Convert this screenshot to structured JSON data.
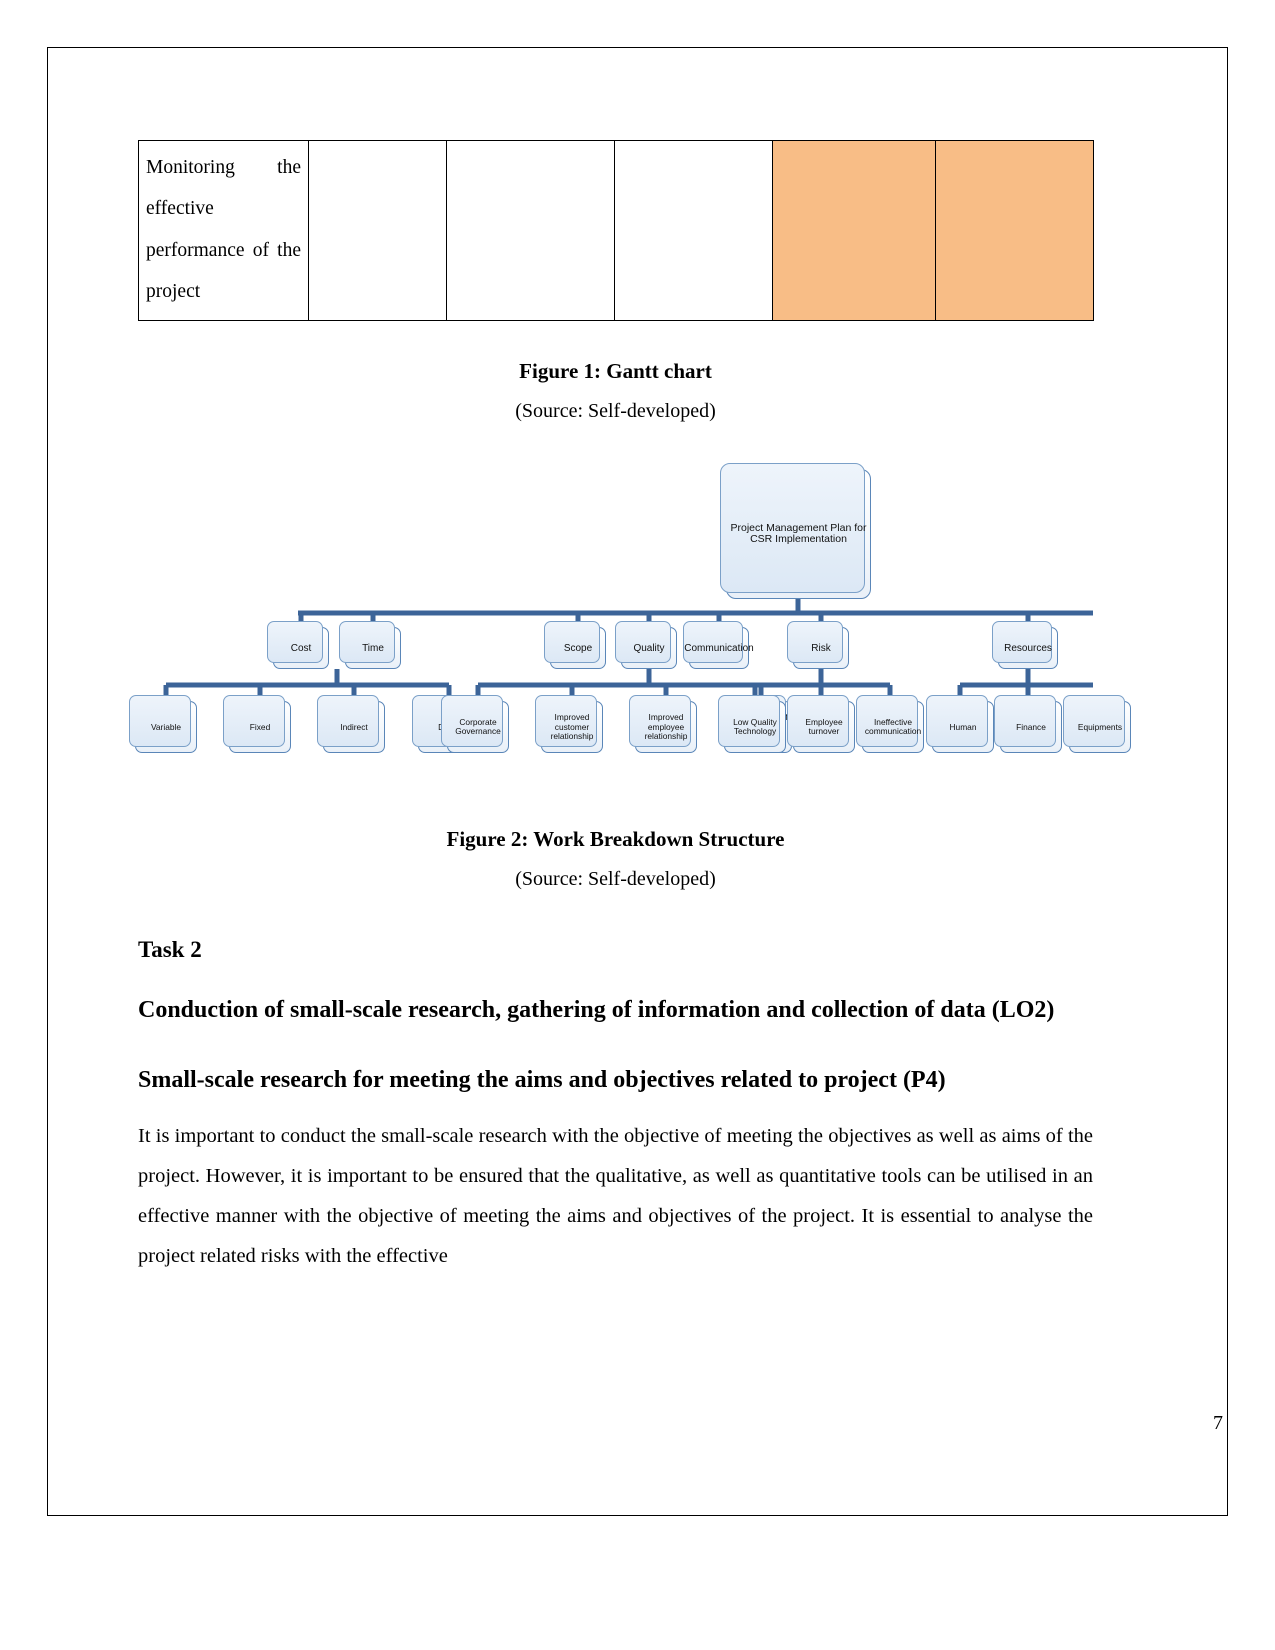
{
  "page": {
    "number": "7"
  },
  "gantt_table": {
    "row_label": "Monitoring the effective performance of the project",
    "cells": [
      {
        "filled": false
      },
      {
        "filled": false
      },
      {
        "filled": false
      },
      {
        "filled": true
      },
      {
        "filled": true
      }
    ],
    "fill_color": "#f8bd86"
  },
  "figures": [
    {
      "caption": "Figure 1: Gantt chart",
      "source": "(Source: Self-developed)"
    },
    {
      "caption": "Figure 2: Work Breakdown Structure",
      "source": "(Source: Self-developed)"
    }
  ],
  "wbs": {
    "root": "Project Management Plan for CSR Implementation",
    "level2": [
      {
        "label": "Cost"
      },
      {
        "label": "Time"
      },
      {
        "label": "Scope"
      },
      {
        "label": "Quality"
      },
      {
        "label": "Communication"
      },
      {
        "label": "Risk"
      },
      {
        "label": "Resources"
      }
    ],
    "level3": [
      {
        "label": "Variable"
      },
      {
        "label": "Fixed"
      },
      {
        "label": "Indirect"
      },
      {
        "label": "Direct"
      },
      {
        "label": "Corporate Governance"
      },
      {
        "label": "Improved customer relationship"
      },
      {
        "label": "Improved employee relationship"
      },
      {
        "label": "Deliverance of business outcome"
      },
      {
        "label": "Low Quality Technology"
      },
      {
        "label": "Employee turnover"
      },
      {
        "label": "Ineffective communication"
      },
      {
        "label": "Human"
      },
      {
        "label": "Finance"
      },
      {
        "label": "Equipments"
      }
    ],
    "line_color": "#3c6498"
  },
  "headings": {
    "task": "Task 2",
    "lo2": "Conduction of small-scale research, gathering of information and collection of data (LO2)",
    "p4": "Small-scale research for meeting the aims and objectives related to project (P4)"
  },
  "paragraph": "It is important to conduct the small-scale research with the objective of meeting the objectives as well as aims of the project. However, it is important to be ensured that the qualitative, as well as quantitative tools can be utilised in an effective manner with the objective of meeting the aims and objectives of the project. It is essential to analyse the project related risks with the effective"
}
